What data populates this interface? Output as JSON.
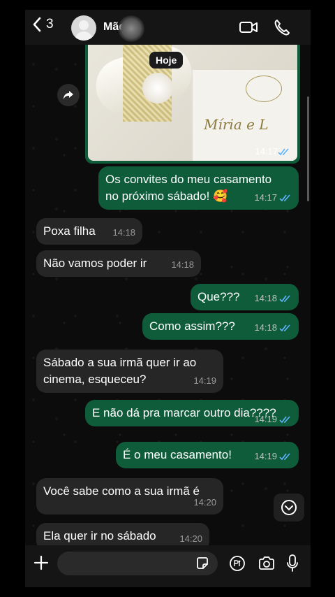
{
  "header": {
    "back_count": "3",
    "contact_name": "Mãe"
  },
  "date_chip": "Hoje",
  "image_message": {
    "names_text": "Míria e L",
    "time": "14:17"
  },
  "messages": [
    {
      "direction": "out",
      "text": "Os convites do meu casamento no próximo sábado! 🥰",
      "time": "14:17"
    },
    {
      "direction": "in",
      "text": "Poxa filha",
      "time": "14:18"
    },
    {
      "direction": "in",
      "text": "Não vamos poder ir",
      "time": "14:18"
    },
    {
      "direction": "out",
      "text": "Que???",
      "time": "14:18"
    },
    {
      "direction": "out",
      "text": "Como assim???",
      "time": "14:18"
    },
    {
      "direction": "in",
      "text": "Sábado a sua irmã quer ir ao cinema, esqueceu?",
      "time": "14:19"
    },
    {
      "direction": "out",
      "text": "E não dá pra marcar outro dia????",
      "time": "14:19"
    },
    {
      "direction": "out",
      "text": "É o meu casamento!",
      "time": "14:19"
    },
    {
      "direction": "in",
      "text": "Você sabe como a sua irmã é",
      "time": "14:20"
    },
    {
      "direction": "in",
      "text": "Ela quer ir no sábado",
      "time": "14:20"
    }
  ],
  "input": {
    "value": "",
    "placeholder": ""
  },
  "colors": {
    "outgoing_bubble": "#0f5c3a",
    "incoming_bubble": "#262626",
    "read_ticks": "#5fb3ff"
  },
  "icons": [
    "back-chevron-icon",
    "video-call-icon",
    "phone-call-icon",
    "forward-icon",
    "scroll-down-icon",
    "plus-icon",
    "sticker-icon",
    "pix-icon",
    "camera-icon",
    "microphone-icon"
  ]
}
